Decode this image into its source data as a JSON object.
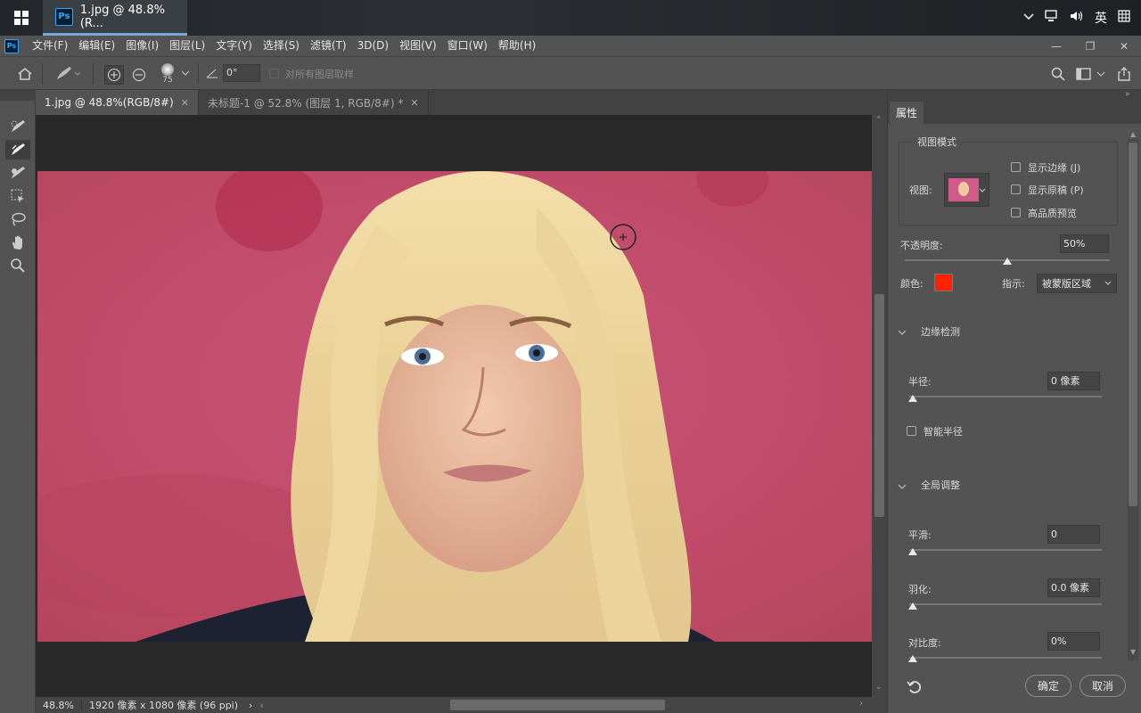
{
  "taskbar": {
    "start_icon": "windows-logo",
    "app_label": "1.jpg @ 48.8%(R...",
    "app_icon": "Ps",
    "tray": {
      "ime": "英",
      "icons": [
        "chevron-up-icon",
        "network-icon",
        "volume-icon",
        "grid-icon"
      ]
    }
  },
  "menubar": {
    "logo": "Ps",
    "items": [
      "文件(F)",
      "编辑(E)",
      "图像(I)",
      "图层(L)",
      "文字(Y)",
      "选择(S)",
      "滤镜(T)",
      "3D(D)",
      "视图(V)",
      "窗口(W)",
      "帮助(H)"
    ],
    "window_controls": [
      "—",
      "❐",
      "✕"
    ]
  },
  "options": {
    "brush_size": "75",
    "angle": "0°",
    "sample_all_layers": "对所有图层取样"
  },
  "tabs": [
    {
      "label": "1.jpg @ 48.8%(RGB/8#)",
      "active": true
    },
    {
      "label": "未标题-1 @ 52.8% (图层 1, RGB/8#) *",
      "active": false
    }
  ],
  "status": {
    "zoom": "48.8%",
    "doc_info": "1920 像素 x 1080 像素 (96 ppi)",
    "arrow": "›"
  },
  "panel": {
    "tab": "属性",
    "view_mode": {
      "title": "视图模式",
      "view_label": "视图:",
      "show_edge": "显示边缘 (J)",
      "show_original": "显示原稿 (P)",
      "hq_preview": "高品质预览"
    },
    "opacity_label": "不透明度:",
    "opacity_value": "50%",
    "opacity_fraction": 0.5,
    "color_label": "颜色:",
    "color_value": "#ff2200",
    "indicate_label": "指示:",
    "indicate_value": "被蒙版区域",
    "edge_detect": {
      "title": "边缘检测",
      "radius_label": "半径:",
      "radius_value": "0 像素",
      "smart_radius": "智能半径"
    },
    "global": {
      "title": "全局调整",
      "smooth_label": "平滑:",
      "smooth_value": "0",
      "feather_label": "羽化:",
      "feather_value": "0.0 像素",
      "contrast_label": "对比度:",
      "contrast_value": "0%"
    },
    "ok": "确定",
    "cancel": "取消"
  },
  "colors": {
    "ui_bg": "#535353",
    "canvas_bg": "#282828",
    "accent": "#31a8ff",
    "photo_bg": "#c4506e"
  }
}
